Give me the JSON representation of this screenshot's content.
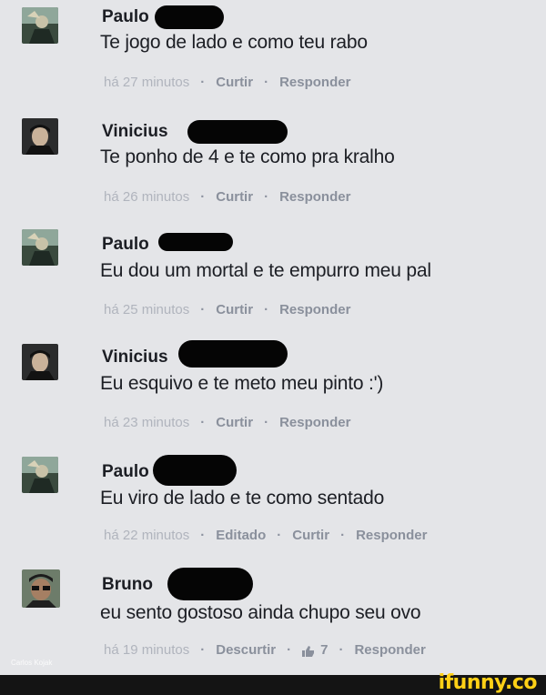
{
  "comments": [
    {
      "author": "Paulo",
      "text": "Te jogo de lado e como teu rabo",
      "time": "há 27 minutos",
      "edited": "",
      "like": "Curtir",
      "likes": "",
      "reply": "Responder"
    },
    {
      "author": "Vinicius",
      "text": "Te ponho de 4 e te como pra kralho",
      "time": "há 26 minutos",
      "edited": "",
      "like": "Curtir",
      "likes": "",
      "reply": "Responder"
    },
    {
      "author": "Paulo",
      "text": "Eu dou um mortal e te empurro meu pal",
      "time": "há 25 minutos",
      "edited": "",
      "like": "Curtir",
      "likes": "",
      "reply": "Responder"
    },
    {
      "author": "Vinicius",
      "text": "Eu esquivo e te meto meu pinto :')",
      "time": "há 23 minutos",
      "edited": "",
      "like": "Curtir",
      "likes": "",
      "reply": "Responder"
    },
    {
      "author": "Paulo",
      "text": "Eu viro de lado e te como sentado",
      "time": "há 22 minutos",
      "edited": "Editado",
      "like": "Curtir",
      "likes": "",
      "reply": "Responder"
    },
    {
      "author": "Bruno",
      "text": "eu sento gostoso ainda chupo seu ovo",
      "time": "há 19 minutos",
      "edited": "",
      "like": "Descurtir",
      "likes": "7",
      "reply": "Responder"
    }
  ],
  "meta_separator": "·",
  "watermark": "Carlos Kojak",
  "logo": "ifunny.co",
  "icons": {
    "like": "thumbs-up-icon"
  },
  "colors": {
    "background": "#e4e5e8",
    "meta": "#8d93a0",
    "footer": "#141414",
    "logo": "#ffd016"
  }
}
